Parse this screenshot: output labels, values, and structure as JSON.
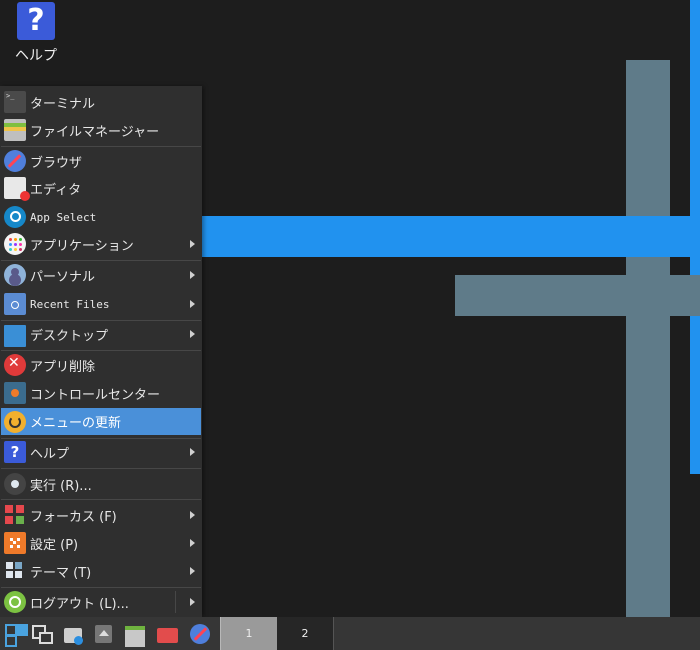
{
  "desktop": {
    "icons": [
      {
        "label": "ヘルプ",
        "icon": "help-icon"
      }
    ],
    "colors": {
      "background": "#1d1d1d",
      "blue": "#2192ef",
      "gray": "#5f7b89"
    }
  },
  "menu": {
    "items": [
      {
        "label": "ターミナル",
        "icon": "terminal-icon"
      },
      {
        "label": "ファイルマネージャー",
        "icon": "file-manager-icon"
      },
      {
        "label": "ブラウザ",
        "icon": "browser-icon"
      },
      {
        "label": "エディタ",
        "icon": "editor-icon"
      },
      {
        "label": "App Select",
        "icon": "app-select-icon"
      },
      {
        "label": "アプリケーション",
        "icon": "applications-icon",
        "submenu": true
      },
      {
        "label": "パーソナル",
        "icon": "personal-icon",
        "submenu": true
      },
      {
        "label": "Recent Files",
        "icon": "recent-files-icon",
        "submenu": true
      },
      {
        "label": "デスクトップ",
        "icon": "desktop-icon",
        "submenu": true
      },
      {
        "label": "アプリ削除",
        "icon": "app-remove-icon"
      },
      {
        "label": "コントロールセンター",
        "icon": "control-center-icon"
      },
      {
        "label": "メニューの更新",
        "icon": "refresh-icon",
        "active": true
      },
      {
        "label": "ヘルプ",
        "icon": "help-icon",
        "submenu": true
      },
      {
        "label": "実行 (R)...",
        "icon": "run-icon"
      },
      {
        "label": "フォーカス (F)",
        "icon": "focus-icon",
        "submenu": true
      },
      {
        "label": "設定 (P)",
        "icon": "settings-icon",
        "submenu": true
      },
      {
        "label": "テーマ (T)",
        "icon": "theme-icon",
        "submenu": true
      },
      {
        "label": "ログアウト (L)...",
        "icon": "logout-icon",
        "submenu": true
      }
    ],
    "active_color": "#4a90d9"
  },
  "taskbar": {
    "launchers": [
      "menu-icon",
      "windows-icon",
      "bag-icon",
      "eject-icon",
      "file-manager-icon",
      "folder-icon",
      "browser-icon"
    ],
    "workspaces": [
      "1",
      "2"
    ],
    "active_workspace": "1"
  }
}
